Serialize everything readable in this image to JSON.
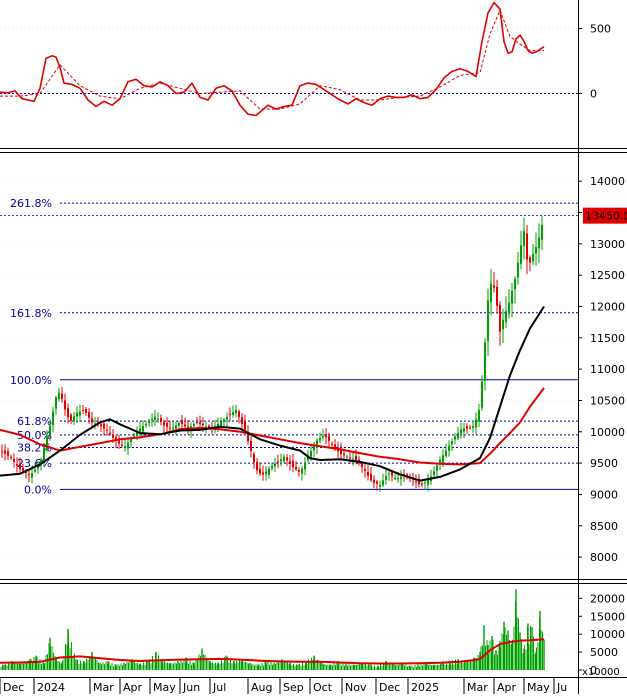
{
  "chart_data": [
    {
      "type": "line",
      "panel": "indicator",
      "y_ticks": [
        "500",
        "0"
      ],
      "y_tick_values": [
        500,
        0
      ],
      "ylim": [
        -420,
        720
      ],
      "reference_line": 0,
      "colors": {
        "main": "#e00000",
        "signal": "#e00000",
        "reference": "#0000a0"
      },
      "series": [
        {
          "x": [
            0,
            8,
            15,
            22,
            28,
            34,
            40,
            46,
            52,
            56,
            60,
            64,
            72,
            80,
            88,
            96,
            104,
            112,
            120,
            128,
            136,
            144,
            152,
            160,
            168,
            176,
            184,
            192,
            200,
            208,
            216,
            224,
            232,
            240,
            248,
            256,
            262,
            268,
            276,
            284,
            292,
            300,
            308,
            316,
            324,
            332,
            340,
            348,
            356,
            364,
            372,
            380,
            388,
            396,
            404,
            412,
            420,
            428,
            436,
            444,
            452,
            460,
            468,
            476,
            482,
            488,
            494,
            500,
            504,
            508,
            512,
            516,
            520,
            524,
            528,
            532,
            536,
            540,
            544
          ],
          "values": [
            10,
            5,
            20,
            -40,
            -50,
            -60,
            40,
            270,
            290,
            280,
            200,
            80,
            70,
            40,
            -50,
            -100,
            -60,
            -90,
            -40,
            90,
            110,
            60,
            50,
            90,
            60,
            0,
            10,
            80,
            -30,
            -50,
            40,
            60,
            20,
            -90,
            -160,
            -170,
            -130,
            -90,
            -120,
            -100,
            -90,
            60,
            80,
            70,
            30,
            -10,
            -50,
            -80,
            -40,
            -70,
            -90,
            -40,
            -20,
            -30,
            -30,
            -10,
            -40,
            -30,
            30,
            120,
            170,
            190,
            170,
            130,
            400,
            620,
            700,
            650,
            400,
            310,
            320,
            420,
            450,
            400,
            330,
            310,
            320,
            340,
            360
          ]
        },
        {
          "x": [
            0,
            20,
            40,
            60,
            80,
            100,
            120,
            140,
            160,
            180,
            200,
            220,
            240,
            260,
            280,
            300,
            320,
            340,
            360,
            380,
            400,
            420,
            440,
            460,
            480,
            490,
            500,
            510,
            520,
            530,
            544
          ],
          "values": [
            -20,
            -20,
            0,
            220,
            60,
            -20,
            -40,
            40,
            80,
            40,
            0,
            10,
            20,
            -120,
            -120,
            -80,
            60,
            30,
            -50,
            -50,
            -30,
            -20,
            50,
            140,
            160,
            460,
            640,
            440,
            380,
            330,
            330
          ]
        }
      ]
    },
    {
      "type": "candlestick",
      "panel": "price",
      "x_labels": [
        "Dec",
        "2024",
        "Mar",
        "Apr",
        "May",
        "Jun",
        "Jul",
        "Aug",
        "Sep",
        "Oct",
        "Nov",
        "Dec",
        "2025",
        "Mar",
        "Apr",
        "May",
        "Ju"
      ],
      "x_label_pos": [
        8,
        42,
        98,
        128,
        158,
        188,
        218,
        256,
        288,
        318,
        350,
        384,
        416,
        472,
        502,
        532,
        562
      ],
      "y_ticks": [
        "14000",
        "13500",
        "13000",
        "12500",
        "12000",
        "11500",
        "11000",
        "10500",
        "10000",
        "9500",
        "9000",
        "8500",
        "8000"
      ],
      "y_tick_values": [
        14000,
        13500,
        13000,
        12500,
        12000,
        11500,
        11000,
        10500,
        10000,
        9500,
        9000,
        8500,
        8000
      ],
      "ylim": [
        7650,
        14450
      ],
      "last_price": "13450.00",
      "fibonacci": [
        {
          "label": "261.8%",
          "value": 13650
        },
        {
          "label": "161.8%",
          "value": 11900
        },
        {
          "label": "100.0%",
          "value": 10830
        },
        {
          "label": "61.8%",
          "value": 10170
        },
        {
          "label": "50.0%",
          "value": 9950
        },
        {
          "label": "38.2%",
          "value": 9750
        },
        {
          "label": "23.6%",
          "value": 9500
        },
        {
          "label": "0.0%",
          "value": 9080
        }
      ],
      "colors": {
        "up": "#00a000",
        "down": "#e00000",
        "ma_fast": "#000000",
        "ma_slow": "#e00000",
        "fib": "#0000a0",
        "price_tag": "#e00000"
      },
      "close": {
        "x": [
          0,
          10,
          20,
          30,
          40,
          50,
          56,
          60,
          64,
          70,
          76,
          84,
          92,
          100,
          108,
          116,
          124,
          132,
          140,
          148,
          156,
          164,
          172,
          180,
          188,
          196,
          204,
          212,
          220,
          228,
          236,
          244,
          250,
          256,
          262,
          268,
          276,
          284,
          292,
          300,
          308,
          316,
          324,
          332,
          340,
          348,
          356,
          364,
          372,
          380,
          388,
          396,
          404,
          412,
          420,
          426,
          432,
          438,
          444,
          450,
          456,
          462,
          468,
          474,
          480,
          484,
          488,
          492,
          496,
          500,
          504,
          508,
          512,
          516,
          520,
          524,
          528,
          532,
          536,
          540,
          544
        ],
        "values": [
          9700,
          9600,
          9400,
          9300,
          9500,
          10100,
          10550,
          10650,
          10400,
          10150,
          10300,
          10350,
          10150,
          10100,
          10000,
          9850,
          9750,
          9900,
          10050,
          10150,
          10250,
          10100,
          10050,
          10150,
          10050,
          10150,
          10100,
          10050,
          10150,
          10250,
          10350,
          10050,
          9750,
          9400,
          9300,
          9400,
          9500,
          9600,
          9450,
          9350,
          9600,
          9850,
          9950,
          9800,
          9650,
          9600,
          9550,
          9400,
          9200,
          9150,
          9350,
          9250,
          9300,
          9250,
          9150,
          9200,
          9300,
          9500,
          9650,
          9800,
          9950,
          10050,
          10050,
          10100,
          10400,
          11200,
          12100,
          12450,
          12150,
          11600,
          11850,
          12000,
          12250,
          12500,
          12900,
          13200,
          12600,
          12800,
          12950,
          13150,
          13450
        ]
      },
      "ma_fast": {
        "x": [
          0,
          20,
          40,
          60,
          80,
          100,
          110,
          120,
          140,
          160,
          180,
          200,
          220,
          240,
          260,
          280,
          300,
          310,
          320,
          340,
          360,
          380,
          400,
          420,
          440,
          460,
          480,
          490,
          500,
          510,
          520,
          530,
          544
        ],
        "values": [
          9300,
          9330,
          9480,
          9700,
          9950,
          10150,
          10200,
          10120,
          9980,
          9960,
          10020,
          10030,
          10080,
          10050,
          9880,
          9780,
          9700,
          9580,
          9550,
          9560,
          9520,
          9450,
          9320,
          9220,
          9280,
          9400,
          9580,
          9900,
          10400,
          10900,
          11300,
          11650,
          12000
        ]
      },
      "ma_slow": {
        "x": [
          0,
          20,
          40,
          60,
          80,
          100,
          120,
          140,
          160,
          180,
          200,
          220,
          240,
          260,
          280,
          300,
          320,
          340,
          360,
          380,
          400,
          420,
          440,
          460,
          480,
          490,
          500,
          510,
          520,
          530,
          544
        ],
        "values": [
          10030,
          9950,
          9800,
          9700,
          9760,
          9820,
          9880,
          9910,
          9960,
          10040,
          10060,
          10040,
          10000,
          9940,
          9880,
          9820,
          9770,
          9720,
          9660,
          9600,
          9560,
          9510,
          9490,
          9480,
          9500,
          9650,
          9820,
          9980,
          10150,
          10400,
          10700
        ]
      }
    },
    {
      "type": "bar",
      "panel": "volume",
      "y_ticks": [
        "20000",
        "15000",
        "10000",
        "5000",
        "0"
      ],
      "y_tick_values": [
        20000,
        15000,
        10000,
        5000,
        0
      ],
      "ylim": [
        0,
        24000
      ],
      "unit_label": "x10000",
      "colors": {
        "bars": "#00a000",
        "ma": "#e00000"
      },
      "bars": {
        "x": [
          4,
          12,
          20,
          30,
          36,
          44,
          50,
          56,
          62,
          68,
          76,
          84,
          92,
          100,
          108,
          116,
          124,
          132,
          140,
          148,
          156,
          162,
          170,
          178,
          186,
          194,
          202,
          210,
          218,
          226,
          234,
          242,
          250,
          258,
          266,
          274,
          282,
          290,
          298,
          306,
          314,
          322,
          330,
          338,
          346,
          354,
          362,
          370,
          378,
          386,
          394,
          402,
          410,
          418,
          426,
          434,
          442,
          450,
          458,
          466,
          474,
          480,
          484,
          488,
          492,
          496,
          500,
          504,
          508,
          512,
          516,
          520,
          524,
          528,
          532,
          536,
          540,
          544
        ],
        "values": [
          1500,
          2500,
          1800,
          3000,
          4000,
          2000,
          9000,
          3500,
          2000,
          11500,
          3000,
          2500,
          5000,
          2000,
          2500,
          1500,
          2000,
          3000,
          1800,
          2500,
          5000,
          3000,
          2000,
          2500,
          3500,
          2000,
          6000,
          2500,
          2000,
          4000,
          2500,
          3000,
          2000,
          1500,
          2500,
          2000,
          3000,
          2000,
          1500,
          2500,
          4000,
          2000,
          1500,
          2500,
          1800,
          1500,
          2000,
          1500,
          1200,
          2500,
          1500,
          1800,
          1200,
          1500,
          2000,
          1500,
          1800,
          2500,
          3000,
          2500,
          3500,
          5000,
          12500,
          7000,
          9500,
          5500,
          8000,
          13500,
          11000,
          7500,
          22500,
          10500,
          6000,
          13000,
          12000,
          5000,
          16500,
          8500
        ]
      },
      "ma": {
        "x": [
          0,
          20,
          40,
          60,
          80,
          100,
          120,
          140,
          160,
          180,
          200,
          220,
          240,
          260,
          280,
          300,
          320,
          340,
          360,
          380,
          400,
          420,
          440,
          460,
          480,
          490,
          500,
          510,
          520,
          530,
          544
        ],
        "values": [
          2000,
          2100,
          2300,
          3500,
          3800,
          3300,
          2800,
          2500,
          2700,
          2900,
          3000,
          3100,
          2900,
          2600,
          2400,
          2300,
          2300,
          2100,
          1900,
          1800,
          1800,
          1900,
          2000,
          2300,
          3000,
          5500,
          7200,
          7800,
          8200,
          8300,
          8600
        ]
      }
    }
  ]
}
